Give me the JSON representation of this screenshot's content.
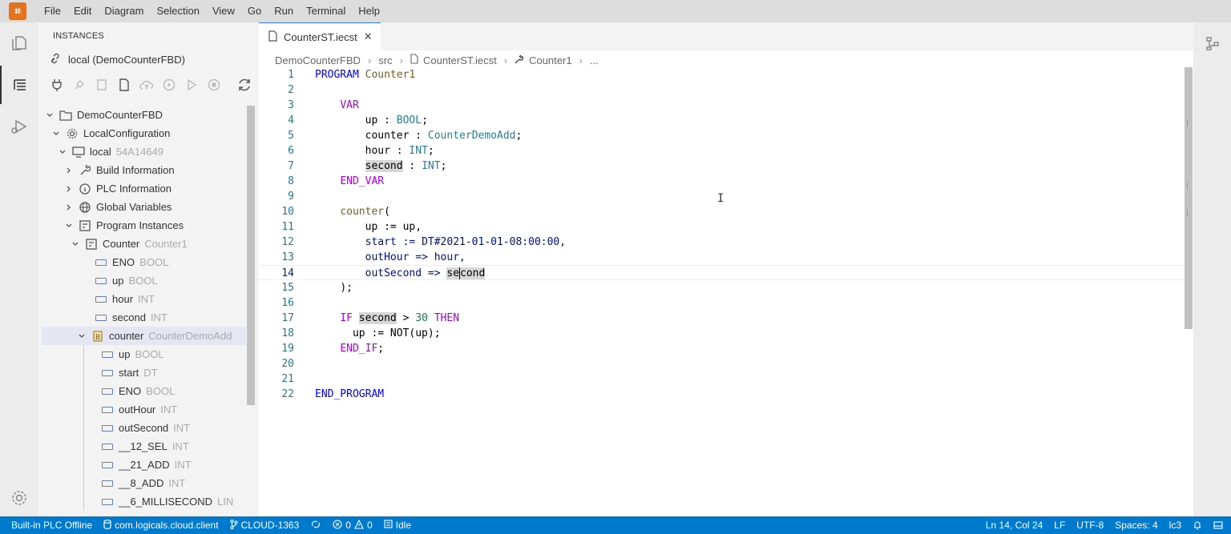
{
  "menubar": {
    "logo": "app-logo",
    "items": [
      "File",
      "Edit",
      "Diagram",
      "Selection",
      "View",
      "Go",
      "Run",
      "Terminal",
      "Help"
    ]
  },
  "sidebar": {
    "title": "INSTANCES",
    "local_label": "local (DemoCounterFBD)",
    "tree": [
      {
        "label": "DemoCounterFBD",
        "type": ""
      },
      {
        "label": "LocalConfiguration",
        "type": ""
      },
      {
        "label": "local",
        "type": "54A14649"
      },
      {
        "label": "Build Information",
        "type": ""
      },
      {
        "label": "PLC Information",
        "type": ""
      },
      {
        "label": "Global Variables",
        "type": ""
      },
      {
        "label": "Program Instances",
        "type": ""
      },
      {
        "label": "Counter",
        "type": "Counter1"
      },
      {
        "label": "ENO",
        "type": "BOOL"
      },
      {
        "label": "up",
        "type": "BOOL"
      },
      {
        "label": "hour",
        "type": "INT"
      },
      {
        "label": "second",
        "type": "INT"
      },
      {
        "label": "counter",
        "type": "CounterDemoAdd"
      },
      {
        "label": "up",
        "type": "BOOL"
      },
      {
        "label": "start",
        "type": "DT"
      },
      {
        "label": "ENO",
        "type": "BOOL"
      },
      {
        "label": "outHour",
        "type": "INT"
      },
      {
        "label": "outSecond",
        "type": "INT"
      },
      {
        "label": "__12_SEL",
        "type": "INT"
      },
      {
        "label": "__21_ADD",
        "type": "INT"
      },
      {
        "label": "__8_ADD",
        "type": "INT"
      },
      {
        "label": "__6_MILLISECOND",
        "type": "LIN"
      }
    ]
  },
  "editor": {
    "tab_label": "CounterST.iecst",
    "breadcrumbs": [
      "DemoCounterFBD",
      "src",
      "CounterST.iecst",
      "Counter1",
      "..."
    ],
    "line_numbers": [
      "1",
      "2",
      "3",
      "4",
      "5",
      "6",
      "7",
      "8",
      "9",
      "10",
      "11",
      "12",
      "13",
      "14",
      "15",
      "16",
      "17",
      "18",
      "19",
      "20",
      "21",
      "22"
    ],
    "code_text": {
      "program": "PROGRAM",
      "counter1": "Counter1",
      "var": "VAR",
      "up_decl": "up",
      "colon": " : ",
      "bool": "BOOL",
      "semi": ";",
      "counter_decl": "counter",
      "counterdemoadd": "CounterDemoAdd",
      "hour_decl": "hour",
      "int": "INT",
      "second_decl": "second",
      "end_var": "END_VAR",
      "counter_call": "counter",
      "open_paren": "(",
      "up_assign": "up := up,",
      "start_assign": "start := DT#2021-01-01-08:00:00,",
      "outhour_assign": "outHour => hour,",
      "outsecond_lhs": "outSecond => ",
      "se": "se",
      "cond": "cond",
      "close_paren": ");",
      "if_kw": "IF",
      "second_ref": "second",
      "gt": " > ",
      "thirty": "30",
      "then_kw": "THEN",
      "up_not": "up := NOT(up);",
      "end_if": "END_IF",
      "end_if_semi": ";",
      "end_program": "END_PROGRAM"
    }
  },
  "statusbar": {
    "plc_status": "Built-in PLC Offline",
    "workspace": "com.logicals.cloud.client",
    "branch": "CLOUD-1363",
    "errors": "0",
    "warnings": "0",
    "state": "Idle",
    "position": "Ln 14, Col 24",
    "eol": "LF",
    "encoding": "UTF-8",
    "spaces": "Spaces: 4",
    "language": "lc3"
  }
}
